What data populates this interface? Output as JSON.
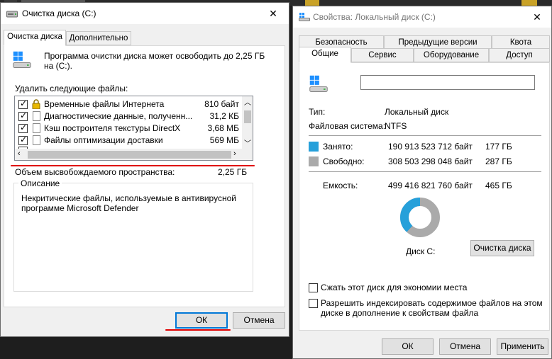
{
  "cleanup": {
    "title": "Очистка диска  (C:)",
    "tabs": [
      "Очистка диска",
      "Дополнительно"
    ],
    "intro": [
      "Программа очистки диска может освободить до 2,25 ГБ",
      "на  (C:)."
    ],
    "list_label": "Удалить следующие файлы:",
    "files": [
      {
        "name": "Временные файлы Интернета",
        "size": "810 байт",
        "checked": true,
        "icon": "lock-icon"
      },
      {
        "name": "Диагностические данные, полученн...",
        "size": "31,2 КБ",
        "checked": true,
        "icon": "file-icon"
      },
      {
        "name": "Кэш построителя текстуры DirectX",
        "size": "3,68 МБ",
        "checked": true,
        "icon": "file-icon"
      },
      {
        "name": "Файлы оптимизации доставки",
        "size": "569 МБ",
        "checked": true,
        "icon": "file-icon"
      }
    ],
    "freed_label": "Объем высвобождаемого пространства:",
    "freed_value": "2,25 ГБ",
    "desc_title": "Описание",
    "desc_text": [
      "Некритические файлы, используемые в антивирусной",
      "программе Microsoft Defender"
    ],
    "ok": "ОК",
    "cancel": "Отмена",
    "close_glyph": "✕",
    "annotation_color": "#e00000"
  },
  "props": {
    "title": "Свойства: Локальный диск (C:)",
    "tabs_row1": [
      "Безопасность",
      "Предыдущие версии",
      "Квота"
    ],
    "tabs_row2": [
      "Общие",
      "Сервис",
      "Оборудование",
      "Доступ"
    ],
    "name_value": "",
    "type_label": "Тип:",
    "type_value": "Локальный диск",
    "fs_label": "Файловая система:",
    "fs_value": "NTFS",
    "used": {
      "label": "Занято:",
      "bytes": "190 913 523 712 байт",
      "gb": "177 ГБ",
      "color": "#26a0da"
    },
    "free": {
      "label": "Свободно:",
      "bytes": "308 503 298 048 байт",
      "gb": "287 ГБ",
      "color": "#aaaaaa"
    },
    "capacity": {
      "label": "Емкость:",
      "bytes": "499 416 821 760 байт",
      "gb": "465 ГБ"
    },
    "used_fraction": 0.3823,
    "drive_label": "Диск С:",
    "cleanup_btn": "Очистка диска",
    "compress_label": "Сжать этот диск для экономии места",
    "index_label": [
      "Разрешить индексировать содержимое файлов на этом",
      "диске в дополнение к свойствам файла"
    ],
    "ok": "ОК",
    "cancel": "Отмена",
    "apply": "Применить",
    "close_glyph": "✕"
  }
}
